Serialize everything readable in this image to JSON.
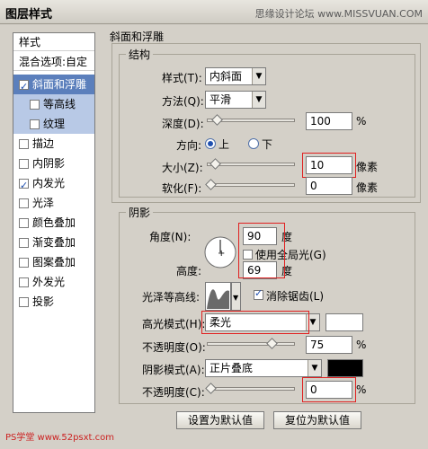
{
  "window": {
    "title": "图层样式",
    "watermark": "思缘设计论坛 www.MISSVUAN.COM"
  },
  "sidebar": {
    "items": [
      {
        "label": "样式"
      },
      {
        "label": "混合选项:自定"
      },
      {
        "label": "斜面和浮雕",
        "checked": true,
        "active": true
      },
      {
        "label": "等高线",
        "checked": false,
        "sub": true
      },
      {
        "label": "纹理",
        "checked": false,
        "sub": true
      },
      {
        "label": "描边",
        "checked": false
      },
      {
        "label": "内阴影",
        "checked": false
      },
      {
        "label": "内发光",
        "checked": true
      },
      {
        "label": "光泽",
        "checked": false
      },
      {
        "label": "颜色叠加",
        "checked": false
      },
      {
        "label": "渐变叠加",
        "checked": false
      },
      {
        "label": "图案叠加",
        "checked": false
      },
      {
        "label": "外发光",
        "checked": false
      },
      {
        "label": "投影",
        "checked": false
      }
    ],
    "bottom_watermark": "PS学堂 www.52psxt.com"
  },
  "bevel": {
    "section_title": "斜面和浮雕",
    "structure_title": "结构",
    "style_label": "样式(T):",
    "style_value": "内斜面",
    "technique_label": "方法(Q):",
    "technique_value": "平滑",
    "depth_label": "深度(D):",
    "depth_value": "100",
    "depth_unit": "%",
    "direction_label": "方向:",
    "direction_up": "上",
    "direction_down": "下",
    "size_label": "大小(Z):",
    "size_value": "10",
    "size_unit": "像素",
    "soften_label": "软化(F):",
    "soften_value": "0",
    "soften_unit": "像素"
  },
  "shading": {
    "title": "阴影",
    "angle_label": "角度(N):",
    "angle_value": "90",
    "angle_unit": "度",
    "global_light_label": "使用全局光(G)",
    "altitude_label": "高度:",
    "altitude_value": "69",
    "altitude_unit": "度",
    "gloss_label": "光泽等高线:",
    "antialias_label": "消除锯齿(L)",
    "highlight_mode_label": "高光模式(H):",
    "highlight_mode_value": "柔光",
    "highlight_color": "#ffffff",
    "highlight_opacity_label": "不透明度(O):",
    "highlight_opacity_value": "75",
    "highlight_opacity_unit": "%",
    "shadow_mode_label": "阴影模式(A):",
    "shadow_mode_value": "正片叠底",
    "shadow_color": "#000000",
    "shadow_opacity_label": "不透明度(C):",
    "shadow_opacity_value": "0",
    "shadow_opacity_unit": "%"
  },
  "buttons": {
    "set_default": "设置为默认值",
    "reset_default": "复位为默认值"
  },
  "sliders": {
    "depth": 0.08,
    "size": 0.05,
    "soften": 0.0,
    "highlight_opacity": 0.75,
    "shadow_opacity": 0.0
  },
  "colors": {
    "active_item": "#5b7fbc",
    "sub_item": "#b8c9e6",
    "highlight_box": "#e02020"
  }
}
